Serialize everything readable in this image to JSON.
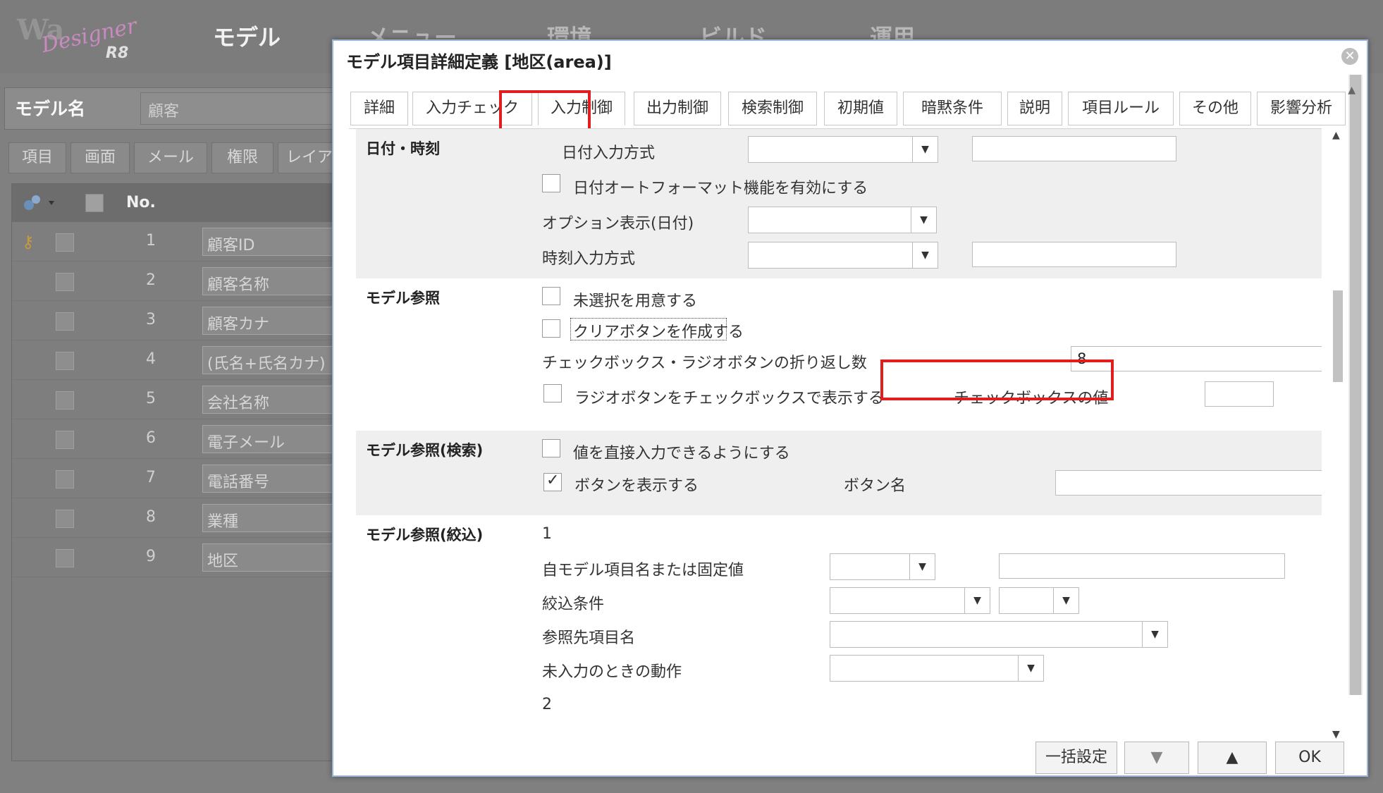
{
  "background": {
    "logo_text": "Designer R8",
    "topnav": [
      "モデル",
      "メニュー",
      "環境",
      "ビルド",
      "運用"
    ],
    "model_name_label": "モデル名",
    "model_name_value": "顧客",
    "tabs": [
      "項目",
      "画面",
      "メール",
      "権限",
      "レイア"
    ],
    "grid_header_no": "No.",
    "rows": [
      {
        "no": "1",
        "name": "顧客ID"
      },
      {
        "no": "2",
        "name": "顧客名称"
      },
      {
        "no": "3",
        "name": "顧客カナ"
      },
      {
        "no": "4",
        "name": "(氏名+氏名カナ)"
      },
      {
        "no": "5",
        "name": "会社名称"
      },
      {
        "no": "6",
        "name": "電子メール"
      },
      {
        "no": "7",
        "name": "電話番号"
      },
      {
        "no": "8",
        "name": "業種"
      },
      {
        "no": "9",
        "name": "地区"
      }
    ]
  },
  "dialog": {
    "title": "モデル項目詳細定義 [地区(area)]",
    "close": "✕",
    "tabs": [
      "詳細",
      "入力チェック",
      "入力制御",
      "出力制御",
      "検索制御",
      "初期値",
      "暗黙条件",
      "説明",
      "項目ルール",
      "その他",
      "影響分析"
    ],
    "active_tab": "入力制御",
    "datetime": {
      "title": "日付・時刻",
      "date_input_label": "日付入力方式",
      "date_autoformat_label": "日付オートフォーマット機能を有効にする",
      "date_option_label": "オプション表示(日付)",
      "time_input_label": "時刻入力方式"
    },
    "model_ref": {
      "title": "モデル参照",
      "unselected_label": "未選択を用意する",
      "clear_button_label": "クリアボタンを作成する",
      "wrap_count_label": "チェックボックス・ラジオボタンの折り返し数",
      "wrap_count_value": "8",
      "radio_as_checkbox_label": "ラジオボタンをチェックボックスで表示する",
      "checkbox_value_label": "チェックボックスの値"
    },
    "model_ref_search": {
      "title": "モデル参照(検索)",
      "direct_input_label": "値を直接入力できるようにする",
      "show_button_label": "ボタンを表示する",
      "button_name_label": "ボタン名"
    },
    "model_ref_filter": {
      "title": "モデル参照(絞込)",
      "group1": "1",
      "self_item_label": "自モデル項目名または固定値",
      "filter_cond_label": "絞込条件",
      "ref_item_label": "参照先項目名",
      "empty_action_label": "未入力のときの動作",
      "group2": "2"
    },
    "buttons": {
      "bulk": "一括設定",
      "down": "▼",
      "up": "▲",
      "ok": "OK"
    },
    "arrow_down": "▼",
    "scroll_up": "▲",
    "scroll_down": "▼"
  }
}
